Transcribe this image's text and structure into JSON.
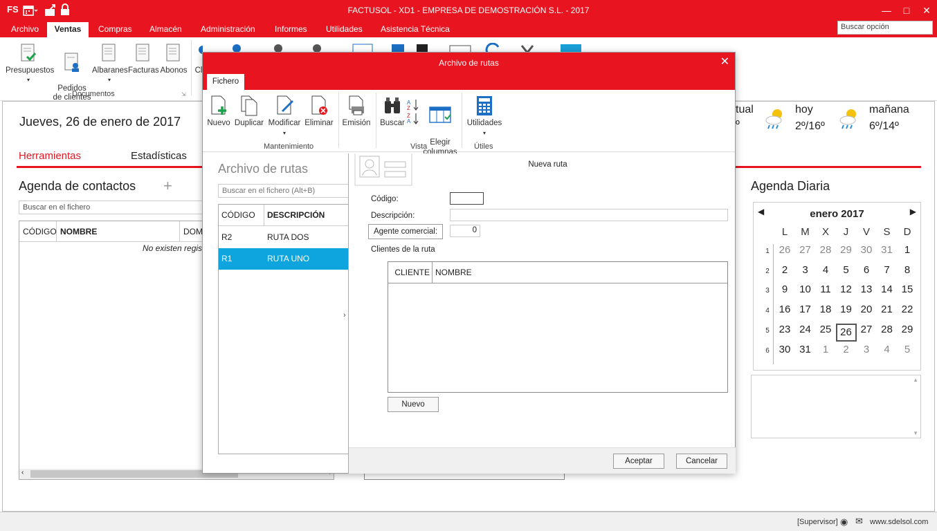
{
  "titlebar": {
    "title": "FACTUSOL - XD1 - EMPRESA DE DEMOSTRACIÓN S.L. - 2017",
    "app_badge": "FS"
  },
  "menu": [
    "Archivo",
    "Ventas",
    "Compras",
    "Almacén",
    "Administración",
    "Informes",
    "Utilidades",
    "Asistencia Técnica"
  ],
  "search_option": {
    "placeholder": "Buscar opción"
  },
  "ribbon": {
    "buttons": [
      {
        "label": "Presupuestos"
      },
      {
        "label": "Pedidos\nde clientes"
      },
      {
        "label": "Albaranes"
      },
      {
        "label": "Facturas"
      },
      {
        "label": "Abonos"
      },
      {
        "label": "Cl"
      }
    ],
    "group_label": "Documentos"
  },
  "home": {
    "date": "Jueves, 26 de enero de 2017",
    "tabs": [
      "Herramientas",
      "Estadísticas"
    ],
    "contacts_title": "Agenda de contactos",
    "search_placeholder": "Buscar en el fichero",
    "table_headers": [
      "CÓDIGO",
      "NOMBRE",
      "DOM"
    ],
    "empty_text": "No existen regist"
  },
  "weather": {
    "actual": "tual",
    "actual_temp": "º",
    "today_label": "hoy",
    "today_temp": "2º/16º",
    "tomorrow_label": "mañana",
    "tomorrow_temp": "6º/14º"
  },
  "agenda_diaria": {
    "title": "Agenda Diaria",
    "month": "enero 2017",
    "weekdays": [
      "L",
      "M",
      "X",
      "J",
      "V",
      "S",
      "D"
    ],
    "weeks": [
      {
        "wk": "1",
        "days": [
          "26",
          "27",
          "28",
          "29",
          "30",
          "31",
          "1"
        ]
      },
      {
        "wk": "2",
        "days": [
          "2",
          "3",
          "4",
          "5",
          "6",
          "7",
          "8"
        ]
      },
      {
        "wk": "3",
        "days": [
          "9",
          "10",
          "11",
          "12",
          "13",
          "14",
          "15"
        ]
      },
      {
        "wk": "4",
        "days": [
          "16",
          "17",
          "18",
          "19",
          "20",
          "21",
          "22"
        ]
      },
      {
        "wk": "5",
        "days": [
          "23",
          "24",
          "25",
          "26",
          "27",
          "28",
          "29"
        ]
      },
      {
        "wk": "6",
        "days": [
          "30",
          "31",
          "1",
          "2",
          "3",
          "4",
          "5"
        ]
      }
    ],
    "today": "26"
  },
  "statusbar": {
    "user": "[Supervisor]",
    "website": "www.sdelsol.com"
  },
  "dialog": {
    "title": "Archivo de rutas",
    "tab": "Fichero",
    "buttons": {
      "nuevo": "Nuevo",
      "duplicar": "Duplicar",
      "modificar": "Modificar",
      "eliminar": "Eliminar",
      "emision": "Emisión",
      "buscar": "Buscar",
      "elegir": "Elegir\ncolumnas",
      "utilidades": "Utilidades"
    },
    "groups": {
      "mantenimiento": "Mantenimiento",
      "vista": "Vista",
      "utiles": "Útiles"
    },
    "list": {
      "title": "Archivo de rutas",
      "search_placeholder": "Buscar en el fichero (Alt+B)",
      "headers": [
        "CÓDIGO",
        "DESCRIPCIÓN"
      ],
      "rows": [
        {
          "codigo": "R2",
          "descripcion": "RUTA DOS"
        },
        {
          "codigo": "R1",
          "descripcion": "RUTA UNO"
        }
      ]
    },
    "form": {
      "heading": "Nueva ruta",
      "codigo_label": "Código:",
      "codigo_value": "",
      "descripcion_label": "Descripción:",
      "descripcion_value": "",
      "agente_label": "Agente comercial:",
      "agente_value": "0",
      "clientes_label": "Clientes de la ruta",
      "clientes_headers": [
        "CLIENTE",
        "NOMBRE"
      ],
      "nuevo_button": "Nuevo",
      "aceptar": "Aceptar",
      "cancelar": "Cancelar"
    }
  },
  "colors": {
    "brand_red": "#e8141f",
    "selection_blue": "#0ea5de"
  }
}
